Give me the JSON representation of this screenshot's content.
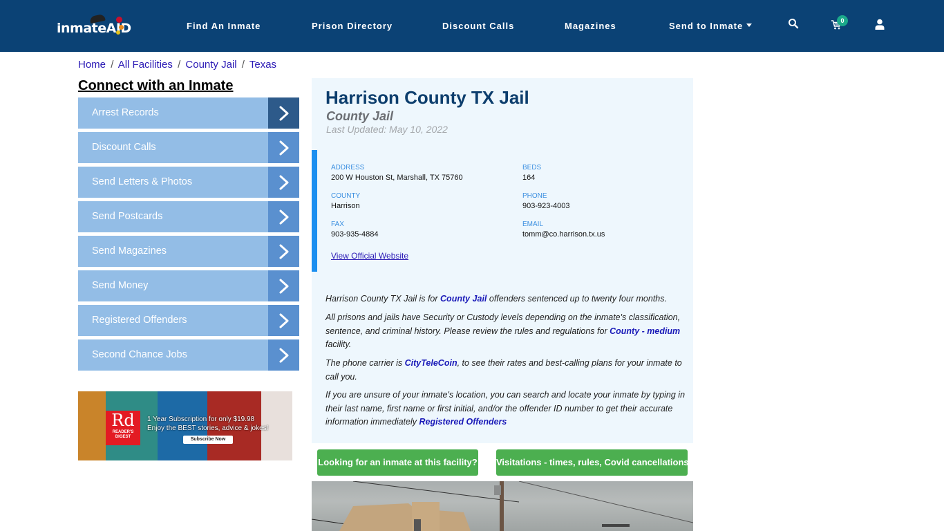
{
  "navbar": {
    "logo_text": "inmateAID",
    "links": [
      {
        "label": "Find An Inmate"
      },
      {
        "label": "Prison Directory"
      },
      {
        "label": "Discount Calls"
      },
      {
        "label": "Magazines"
      },
      {
        "label": "Send to Inmate",
        "has_dropdown": true
      }
    ],
    "icons": [
      "search-icon",
      "cart-icon",
      "user-icon"
    ],
    "cart_count": "0",
    "colors": {
      "background": "#0b4275",
      "badge": "#1ba98a"
    }
  },
  "breadcrumb": [
    {
      "label": "Home"
    },
    {
      "label": "All Facilities"
    },
    {
      "label": "County Jail"
    },
    {
      "label": "Texas"
    }
  ],
  "breadcrumb_separator": "/",
  "sidebar": {
    "title": "Connect with an Inmate",
    "items": [
      {
        "label": "Arrest Records"
      },
      {
        "label": "Discount Calls"
      },
      {
        "label": "Send Letters & Photos"
      },
      {
        "label": "Send Postcards"
      },
      {
        "label": "Send Magazines"
      },
      {
        "label": "Send Money"
      },
      {
        "label": "Registered Offenders"
      },
      {
        "label": "Second Chance Jobs"
      }
    ]
  },
  "ad": {
    "brand_logo": "Rd",
    "brand_name": "READER'S DIGEST",
    "line1": "1 Year Subscription for only $19.98",
    "line2": "Enjoy the BEST stories, advice & jokes!",
    "cta": "Subscribe Now"
  },
  "facility": {
    "name": "Harrison County TX Jail",
    "type": "County Jail",
    "last_updated": "Last Updated: May 10, 2022",
    "info": {
      "address_label": "ADDRESS",
      "address": "200 W Houston St, Marshall, TX 75760",
      "beds_label": "BEDS",
      "beds": "164",
      "county_label": "COUNTY",
      "county": "Harrison",
      "phone_label": "PHONE",
      "phone": "903-923-4003",
      "fax_label": "FAX",
      "fax": "903-935-4884",
      "email_label": "EMAIL",
      "email": "tomm@co.harrison.tx.us",
      "website_link": "View Official Website"
    },
    "description": {
      "p1_pre": "Harrison County TX Jail is for ",
      "p1_link": "County Jail",
      "p1_post": " offenders sentenced up to twenty four months.",
      "p2_pre": "All prisons and jails have Security or Custody levels depending on the inmate's classification, sentence, and criminal history. Please review the rules and regulations for ",
      "p2_link": "County - medium",
      "p2_post": " facility.",
      "p3_pre": "The phone carrier is ",
      "p3_link": "CityTeleCoin",
      "p3_post": ", to see their rates and best-calling plans for your inmate to call you.",
      "p4_pre": "If you are unsure of your inmate's location, you can search and locate your inmate by typing in their last name, first name or first initial, and/or the offender ID number to get their accurate information immediately ",
      "p4_link": "Registered Offenders"
    }
  },
  "buttons": {
    "find_inmate": "Looking for an inmate at this facility?",
    "visitations": "Visitations - times, rules, Covid cancellations"
  }
}
